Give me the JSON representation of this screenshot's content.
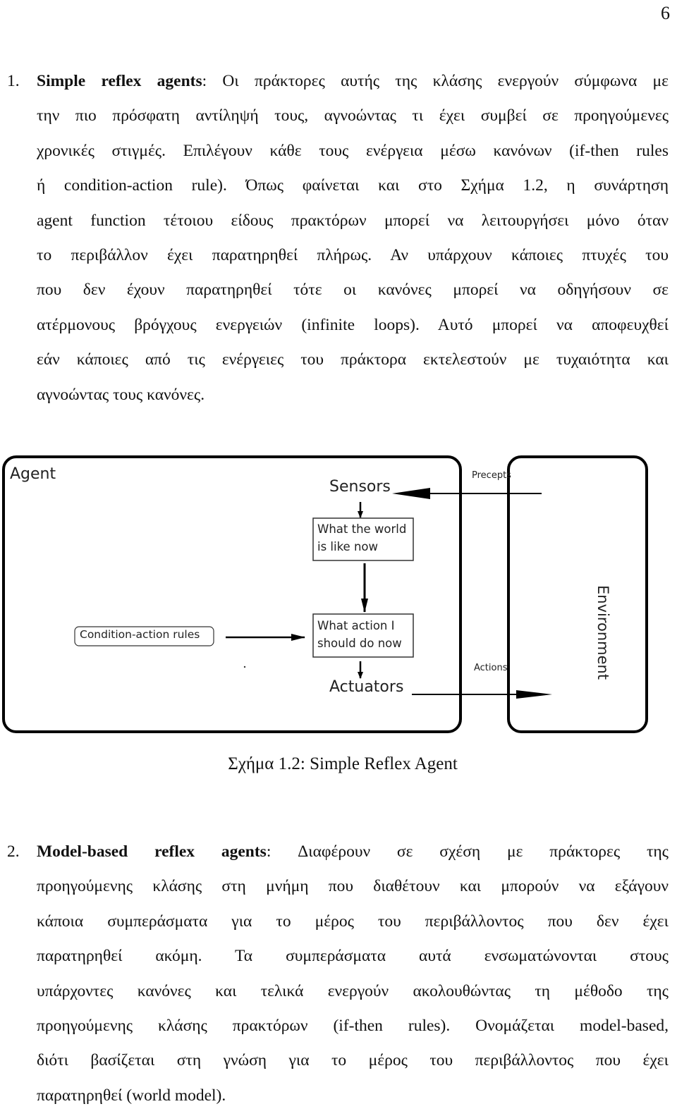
{
  "page_number": "6",
  "section1": {
    "number": "1.",
    "term": "Simple reflex agents",
    "lines": [
      ": Οι πράκτορες αυτής της κλάσης ενεργούν σύμφωνα με",
      "την πιο πρόσφατη αντίληψή τους, αγνοώντας τι έχει συμβεί σε προηγούμενες",
      "χρονικές στιγμές. Επιλέγουν κάθε τους ενέργεια μέσω κανόνων (if-then rules",
      "ή condition-action rule). Όπως φαίνεται και στο Σχήμα 1.2, η συνάρτηση",
      "agent function τέτοιου είδους πρακτόρων μπορεί να λειτουργήσει μόνο όταν",
      "το περιβάλλον έχει παρατηρηθεί πλήρως. Αν υπάρχουν κάποιες πτυχές του",
      "που δεν έχουν παρατηρηθεί τότε οι κανόνες μπορεί να οδηγήσουν σε",
      "ατέρμονους βρόγχους ενεργειών (infinite loops). Αυτό μπορεί να αποφευχθεί",
      "εάν κάποιες από τις ενέργειες του πράκτορα εκτελεστούν με τυχαιότητα και",
      "αγνοώντας τους κανόνες."
    ]
  },
  "figure": {
    "agent_label": "Agent",
    "sensors_label": "Sensors",
    "world_box": [
      "What the world",
      "is like now"
    ],
    "action_box": [
      "What action I",
      "should do now"
    ],
    "rules_label": "Condition-action rules",
    "actuators_label": "Actuators",
    "precepts_label": "Precepts",
    "actions_label": "Actions",
    "environment_label": "Environment",
    "caption": "Σχήμα 1.2: Simple Reflex Agent"
  },
  "section2": {
    "number": "2.",
    "term": "Model-based reflex agents",
    "lines": [
      ": Διαφέρουν σε σχέση με πράκτορες της",
      "προηγούμενης κλάσης στη μνήμη που διαθέτουν και μπορούν να εξάγουν",
      "κάποια συμπεράσματα για το μέρος του περιβάλλοντος που δεν έχει",
      "παρατηρηθεί ακόμη.  Τα συμπεράσματα αυτά ενσωματώνονται στους",
      "υπάρχοντες κανόνες και τελικά ενεργούν ακολουθώντας τη μέθοδο της",
      "προηγούμενης κλάσης πρακτόρων (if-then rules). Ονομάζεται model-based,",
      "διότι βασίζεται στη γνώση για το μέρος του περιβάλλοντος που έχει",
      "παρατηρηθεί (world model)."
    ]
  }
}
